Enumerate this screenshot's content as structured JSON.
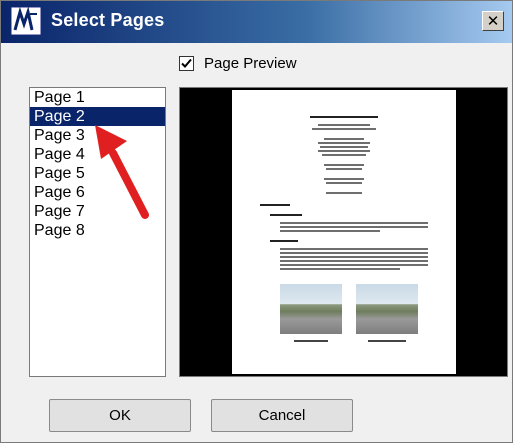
{
  "window": {
    "title": "Select Pages",
    "close_label": "✕"
  },
  "preview": {
    "checkbox_label": "Page Preview",
    "checked": true
  },
  "page_list": {
    "items": [
      "Page 1",
      "Page 2",
      "Page 3",
      "Page 4",
      "Page 5",
      "Page 6",
      "Page 7",
      "Page 8"
    ],
    "selected_index": 1
  },
  "buttons": {
    "ok_label": "OK",
    "cancel_label": "Cancel"
  },
  "colors": {
    "selection": "#0a246a",
    "arrow": "#e02020"
  }
}
